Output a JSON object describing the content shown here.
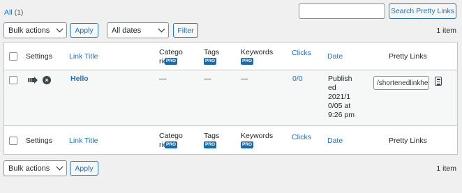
{
  "filter": {
    "all_label": "All",
    "all_count": "(1)"
  },
  "search": {
    "placeholder": "",
    "button": "Search Pretty Links"
  },
  "top_nav": {
    "bulk_action": "Bulk actions",
    "apply": "Apply",
    "dates": "All dates",
    "filter": "Filter",
    "items": "1 item"
  },
  "bottom_nav": {
    "bulk_action": "Bulk actions",
    "apply": "Apply",
    "items": "1 item"
  },
  "columns": {
    "settings": "Settings",
    "link_title": "Link Title",
    "categories": "Categories",
    "tags": "Tags",
    "keywords": "Keywords",
    "clicks": "Clicks",
    "date": "Date",
    "pretty_links": "Pretty Links",
    "pro_badge": "PRO"
  },
  "row": {
    "title": "Hello",
    "categories": "—",
    "tags": "—",
    "keywords": "—",
    "clicks": "0/0",
    "date_status": "Published",
    "date_value": "2021/10/05 at 9:26 pm",
    "pretty_link": "/shortenedlinkhello"
  },
  "icons": {
    "redirect": "arrow-redirect-icon",
    "delete": "x-circle-icon",
    "copy": "clipboard-icon"
  },
  "colors": {
    "link": "#2271b1",
    "pro_badge": "#1a6aa9",
    "background": "#f0f0f1"
  }
}
